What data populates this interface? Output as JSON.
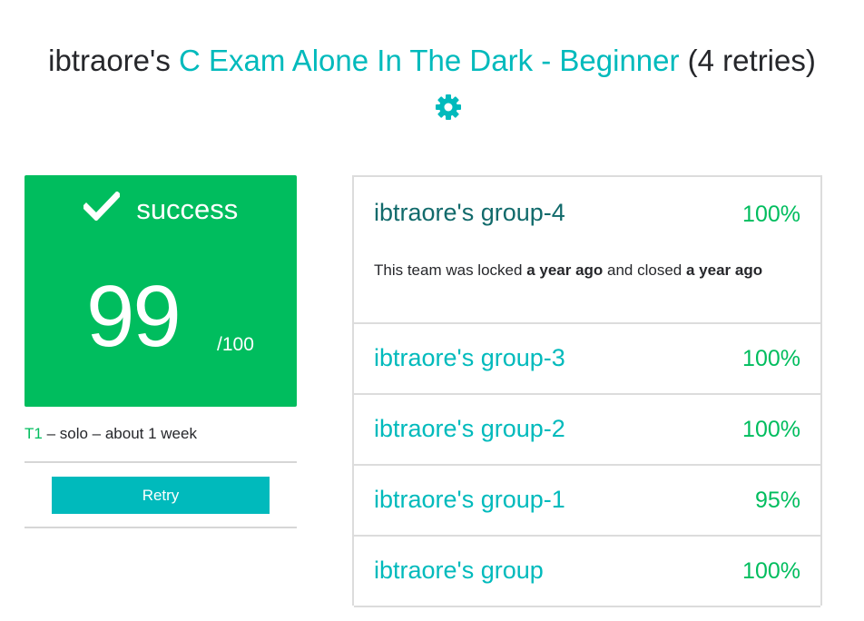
{
  "header": {
    "user_prefix": "ibtraore's",
    "project_name": "C Exam Alone In The Dark - Beginner",
    "retries_text": "(4 retries)",
    "settings_icon": "gear-icon",
    "accent_color": "#00babc"
  },
  "score_card": {
    "status_icon": "check-icon",
    "status": "success",
    "score": "99",
    "max": "/100",
    "bg_color": "#00bd5e"
  },
  "meta": {
    "team": "T1",
    "rest": " – solo – about 1 week"
  },
  "retry_button": {
    "label": "Retry"
  },
  "groups": [
    {
      "name": "ibtraore's group-4",
      "score": "100%",
      "note": {
        "prefix": "This team was locked ",
        "locked": "a year ago",
        "middle": " and closed ",
        "closed": "a year ago"
      }
    },
    {
      "name": "ibtraore's group-3",
      "score": "100%"
    },
    {
      "name": "ibtraore's group-2",
      "score": "100%"
    },
    {
      "name": "ibtraore's group-1",
      "score": "95%"
    },
    {
      "name": "ibtraore's group",
      "score": "100%"
    }
  ]
}
